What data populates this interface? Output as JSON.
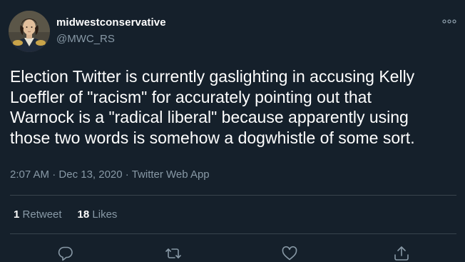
{
  "tweet": {
    "author": {
      "display_name": "midwestconservative",
      "handle": "@MWC_RS",
      "avatar_icon": "portrait-avatar"
    },
    "more_icon": "more-options-icon",
    "text": "Election Twitter is currently gaslighting in accusing Kelly\nLoeffler of \"racism\" for accurately pointing out that\nWarnock is a \"radical liberal\" because apparently using\nthose two words is somehow a dogwhistle of some sort.",
    "time": "2:07 AM",
    "sep1": " · ",
    "date": "Dec 13, 2020",
    "sep2": " · ",
    "source": "Twitter Web App",
    "stats": {
      "retweets_count": "1",
      "retweets_label": "Retweet",
      "likes_count": "18",
      "likes_label": "Likes"
    },
    "actions": [
      "reply-icon",
      "retweet-icon",
      "like-icon",
      "share-icon"
    ]
  },
  "colors": {
    "background": "#15202b",
    "text": "#ffffff",
    "secondary": "#8899a6",
    "divider": "#38444d"
  }
}
